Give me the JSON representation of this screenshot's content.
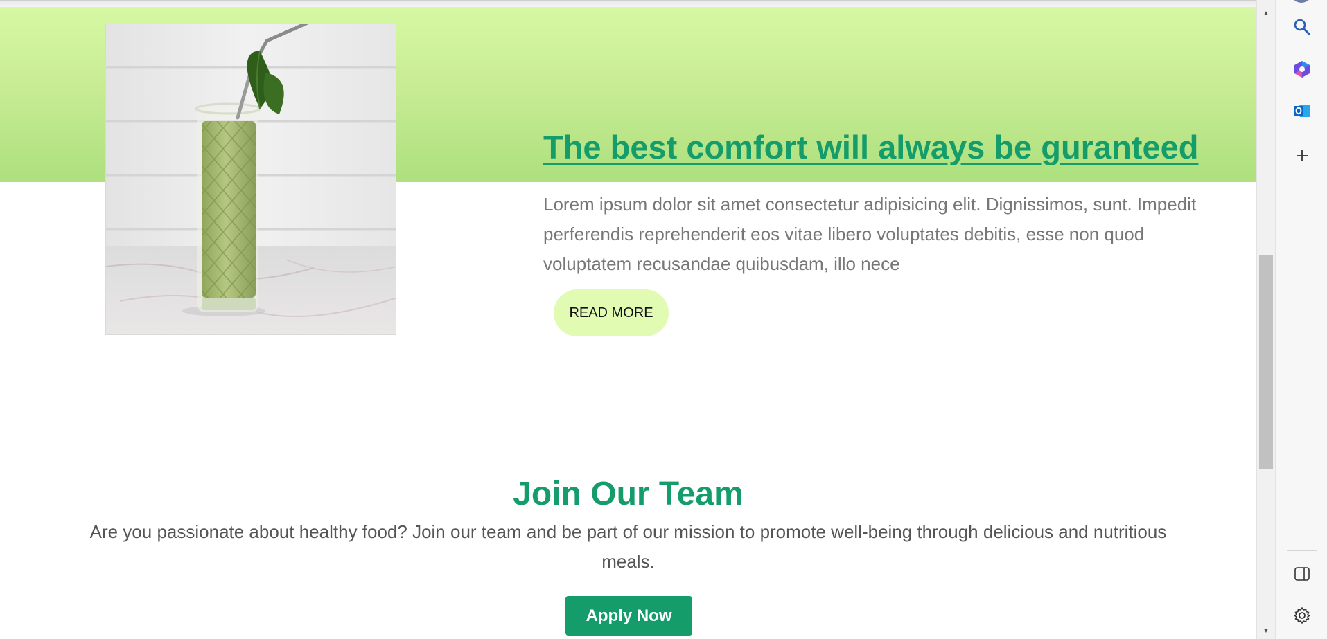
{
  "banner": {
    "image_alt": "Green smoothie in a tall glass with a metal straw and a spinach leaf"
  },
  "feature": {
    "headline": "The best comfort will always be guranteed",
    "body": "Lorem ipsum dolor sit amet consectetur adipisicing elit. Dignissimos, sunt. Impedit perferendis reprehenderit eos vitae libero voluptates debitis, esse non quod voluptatem recusandae quibusdam, illo nece",
    "read_more_label": "READ MORE"
  },
  "join": {
    "title": "Join Our Team",
    "text": "Are you passionate about healthy food? Join our team and be part of our mission to promote well-being through delicious and nutritious meals.",
    "apply_label": "Apply Now"
  },
  "scrollbar": {
    "position_fraction": 0.4
  },
  "sidebar": {
    "icons": [
      "search-icon",
      "copilot-icon",
      "outlook-icon",
      "add-icon",
      "sidebar-toggle-icon",
      "settings-icon"
    ]
  },
  "colors": {
    "brand_green": "#149c6b",
    "banner_light": "#d6f8a4",
    "banner_dark": "#ade07e",
    "button_light": "#e1fbb3",
    "body_text": "#777777"
  }
}
